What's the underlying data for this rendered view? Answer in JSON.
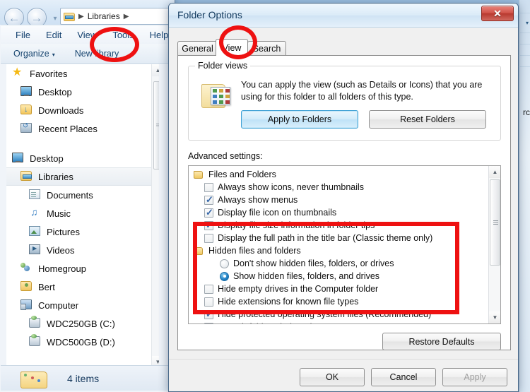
{
  "explorer": {
    "address": {
      "crumb": "Libraries",
      "sep": "▶",
      "icon": "library-folder-icon"
    },
    "nav": {
      "back": "←",
      "forward": "→",
      "dropdown": "▾"
    },
    "menu": [
      "File",
      "Edit",
      "View",
      "Tools",
      "Help"
    ],
    "toolbar": {
      "organize": "Organize",
      "organize_caret": "▾",
      "new_library": "New library"
    },
    "tree": [
      {
        "label": "Favorites",
        "icon": "star-icon",
        "indent": 0,
        "selected": false
      },
      {
        "label": "Desktop",
        "icon": "monitor-icon",
        "indent": 1,
        "selected": false
      },
      {
        "label": "Downloads",
        "icon": "downloads-icon",
        "indent": 1,
        "selected": false
      },
      {
        "label": "Recent Places",
        "icon": "recent-icon",
        "indent": 1,
        "selected": false
      },
      {
        "label": "Desktop",
        "icon": "monitor-icon",
        "indent": 0,
        "selected": false
      },
      {
        "label": "Libraries",
        "icon": "library-icon",
        "indent": 1,
        "selected": true
      },
      {
        "label": "Documents",
        "icon": "documents-icon",
        "indent": 2,
        "selected": false
      },
      {
        "label": "Music",
        "icon": "music-icon",
        "indent": 2,
        "selected": false
      },
      {
        "label": "Pictures",
        "icon": "pictures-icon",
        "indent": 2,
        "selected": false
      },
      {
        "label": "Videos",
        "icon": "videos-icon",
        "indent": 2,
        "selected": false
      },
      {
        "label": "Homegroup",
        "icon": "homegroup-icon",
        "indent": 1,
        "selected": false
      },
      {
        "label": "Bert",
        "icon": "user-folder-icon",
        "indent": 1,
        "selected": false
      },
      {
        "label": "Computer",
        "icon": "computer-icon",
        "indent": 1,
        "selected": false
      },
      {
        "label": "WDC250GB (C:)",
        "icon": "drive-icon",
        "indent": 2,
        "selected": false
      },
      {
        "label": "WDC500GB (D:)",
        "icon": "drive-icon",
        "indent": 2,
        "selected": false
      }
    ],
    "status": {
      "count_text": "4 items",
      "icon": "folder-items-icon"
    },
    "scrollbar": {
      "up": "▲",
      "down": "▼"
    }
  },
  "dialog": {
    "title": "Folder Options",
    "close_label": "✕",
    "tabs": [
      {
        "label": "General",
        "active": false
      },
      {
        "label": "View",
        "active": true
      },
      {
        "label": "Search",
        "active": false
      }
    ],
    "folder_views": {
      "legend": "Folder views",
      "description": "You can apply the view (such as Details or Icons) that you are using for this folder to all folders of this type.",
      "apply_button": "Apply to Folders",
      "reset_button": "Reset Folders",
      "icon": "folder-views-icon"
    },
    "advanced": {
      "label": "Advanced settings:",
      "scrollbar": {
        "up": "▲",
        "down": "▼"
      },
      "rows": [
        {
          "type": "group",
          "label": "Files and Folders",
          "checked": false
        },
        {
          "type": "checkbox",
          "label": "Always show icons, never thumbnails",
          "checked": false
        },
        {
          "type": "checkbox",
          "label": "Always show menus",
          "checked": true
        },
        {
          "type": "checkbox",
          "label": "Display file icon on thumbnails",
          "checked": true
        },
        {
          "type": "checkbox",
          "label": "Display file size information in folder tips",
          "checked": true
        },
        {
          "type": "checkbox",
          "label": "Display the full path in the title bar (Classic theme only)",
          "checked": false
        },
        {
          "type": "group",
          "label": "Hidden files and folders",
          "checked": false
        },
        {
          "type": "radio",
          "label": "Don't show hidden files, folders, or drives",
          "checked": false
        },
        {
          "type": "radio",
          "label": "Show hidden files, folders, and drives",
          "checked": true
        },
        {
          "type": "checkbox",
          "label": "Hide empty drives in the Computer folder",
          "checked": false
        },
        {
          "type": "checkbox",
          "label": "Hide extensions for known file types",
          "checked": false
        },
        {
          "type": "checkbox",
          "label": "Hide protected operating system files (Recommended)",
          "checked": true
        },
        {
          "type": "checkbox",
          "label": "Launch folder windows in a separate process",
          "checked": false
        }
      ]
    },
    "restore_button": "Restore Defaults",
    "footer": {
      "ok": "OK",
      "cancel": "Cancel",
      "apply": "Apply"
    }
  },
  "annotations": {
    "circle_tools": "Tools",
    "circle_view": "View",
    "rect_hidden_files": "Hidden files and folders settings",
    "color": "#ee1111"
  },
  "background": {
    "sliver_text": "rc",
    "caret": "▾"
  }
}
